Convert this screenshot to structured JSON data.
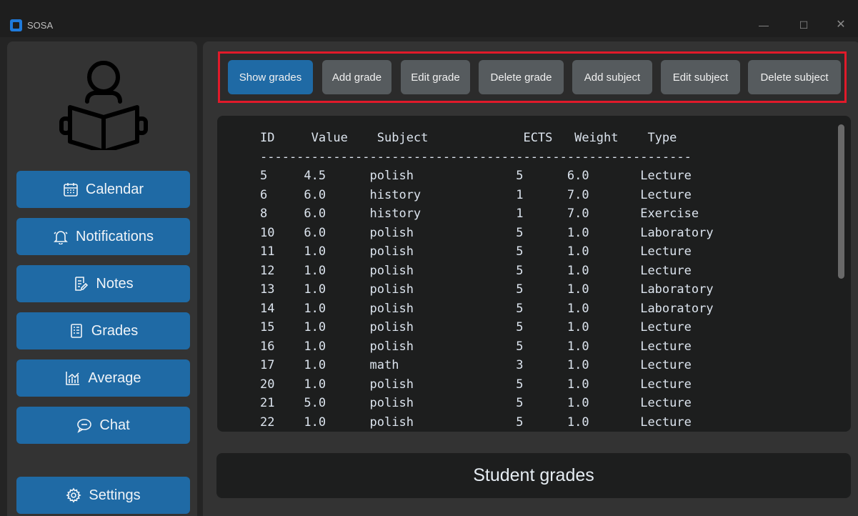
{
  "window": {
    "title": "SOSA",
    "minimize": "—",
    "maximize": "☐",
    "close": "✕"
  },
  "sidebar": {
    "items": [
      {
        "label": "Calendar",
        "icon": "calendar-icon"
      },
      {
        "label": "Notifications",
        "icon": "bell-icon"
      },
      {
        "label": "Notes",
        "icon": "notes-icon"
      },
      {
        "label": "Grades",
        "icon": "grades-icon"
      },
      {
        "label": "Average",
        "icon": "chart-icon"
      },
      {
        "label": "Chat",
        "icon": "chat-icon"
      }
    ],
    "settings": {
      "label": "Settings",
      "icon": "gear-icon"
    }
  },
  "toolbar": {
    "buttons": [
      {
        "label": "Show grades",
        "active": true
      },
      {
        "label": "Add grade",
        "active": false
      },
      {
        "label": "Edit grade",
        "active": false
      },
      {
        "label": "Delete grade",
        "active": false
      },
      {
        "label": "Add subject",
        "active": false
      },
      {
        "label": "Edit subject",
        "active": false
      },
      {
        "label": "Delete subject",
        "active": false
      }
    ]
  },
  "grades": {
    "text": "ID     Value    Subject             ECTS   Weight    Type\n-----------------------------------------------------------\n5     4.5      polish              5      6.0       Lecture\n6     6.0      history             1      7.0       Lecture\n8     6.0      history             1      7.0       Exercise\n10    6.0      polish              5      1.0       Laboratory\n11    1.0      polish              5      1.0       Lecture\n12    1.0      polish              5      1.0       Lecture\n13    1.0      polish              5      1.0       Laboratory\n14    1.0      polish              5      1.0       Laboratory\n15    1.0      polish              5      1.0       Lecture\n16    1.0      polish              5      1.0       Lecture\n17    1.0      math                3      1.0       Lecture\n20    1.0      polish              5      1.0       Lecture\n21    5.0      polish              5      1.0       Lecture\n22    1.0      polish              5      1.0       Lecture"
  },
  "status": {
    "label": "Student grades"
  },
  "colors": {
    "accent": "#1f6aa5",
    "highlight": "#e11a2a",
    "background": "#242424"
  }
}
